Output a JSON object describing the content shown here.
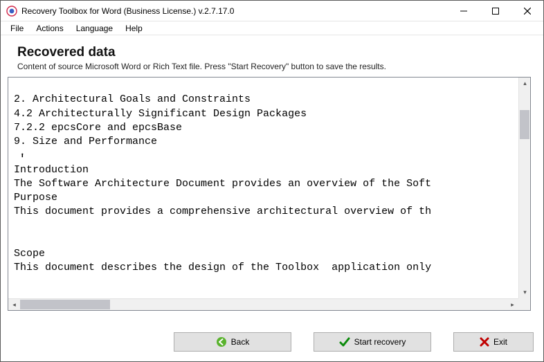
{
  "window": {
    "title": "Recovery Toolbox for Word (Business License.) v.2.7.17.0"
  },
  "menu": {
    "file": "File",
    "actions": "Actions",
    "language": "Language",
    "help": "Help"
  },
  "header": {
    "title": "Recovered data",
    "subtitle": "Content of source Microsoft Word or Rich Text file. Press \"Start Recovery\" button to save the results."
  },
  "document": {
    "lines": [
      "",
      "2. Architectural Goals and Constraints ",
      "4.2 Architecturally Significant Design Packages ",
      "7.2.2 epcsCore and epcsBase ",
      "9. Size and Performance ",
      " ARROW",
      "Introduction",
      "The Software Architecture Document provides an overview of the Soft",
      "Purpose",
      "This document provides a comprehensive architectural overview of th",
      "",
      "",
      "Scope",
      "This document describes the design of the Toolbox  application only"
    ]
  },
  "buttons": {
    "back": "Back",
    "start_recovery": "Start recovery",
    "exit": "Exit"
  }
}
